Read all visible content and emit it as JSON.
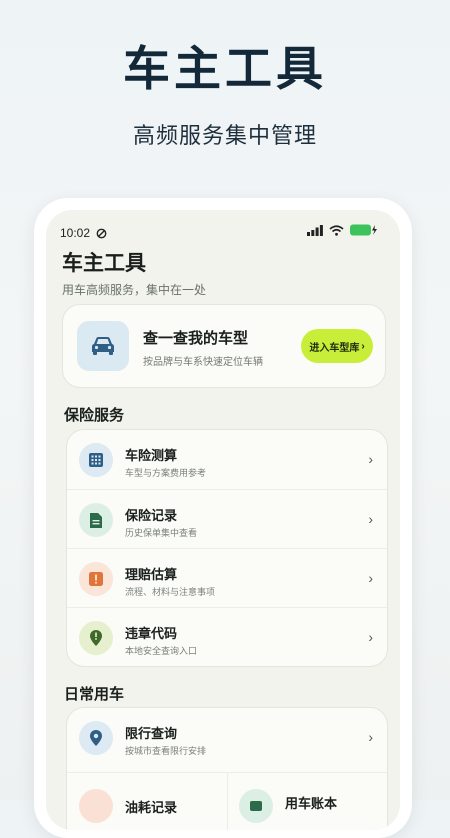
{
  "hero": {
    "title": "车主工具",
    "subtitle": "高频服务集中管理"
  },
  "status_bar": {
    "time": "10:02"
  },
  "app": {
    "title": "车主工具",
    "subtitle": "用车高频服务，集中在一处"
  },
  "model_card": {
    "title": "查一查我的车型",
    "subtitle": "按品牌与车系快速定位车辆",
    "button": "进入车型库",
    "button_chevron": "›"
  },
  "insurance": {
    "title": "保险服务",
    "items": [
      {
        "title": "车险测算",
        "subtitle": "车型与方案费用参考",
        "icon": "calculator-icon",
        "color": "#dde9f3",
        "fg": "#2f5f86"
      },
      {
        "title": "保险记录",
        "subtitle": "历史保单集中查看",
        "icon": "document-icon",
        "color": "#dcefe4",
        "fg": "#2c6a4a"
      },
      {
        "title": "理赔估算",
        "subtitle": "流程、材料与注意事项",
        "icon": "alert-icon",
        "color": "#fbe4d8",
        "fg": "#e0743b"
      },
      {
        "title": "违章代码",
        "subtitle": "本地安全查询入口",
        "icon": "map-pin-icon",
        "color": "#e6f0cf",
        "fg": "#3d6a2b"
      }
    ]
  },
  "daily": {
    "title": "日常用车",
    "items": [
      {
        "title": "限行查询",
        "subtitle": "按城市查看限行安排",
        "icon": "location-icon",
        "color": "#dde9f3",
        "fg": "#2f5f86"
      }
    ],
    "half_items": [
      {
        "title": "油耗记录",
        "icon": "fuel-icon",
        "color": "#fbe0d6"
      },
      {
        "title": "用车账本",
        "icon": "wallet-icon",
        "color": "#dcefe4"
      }
    ]
  },
  "chevron": "›"
}
